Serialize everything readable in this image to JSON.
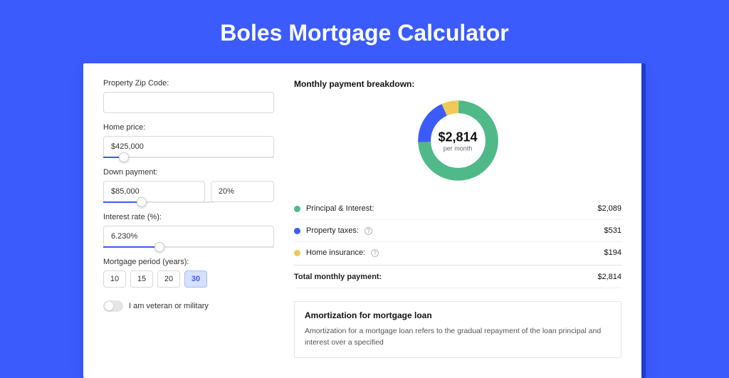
{
  "page_title": "Boles Mortgage Calculator",
  "form": {
    "zip_label": "Property Zip Code:",
    "zip_value": "",
    "home_price_label": "Home price:",
    "home_price_value": "$425,000",
    "down_payment_label": "Down payment:",
    "down_payment_value": "$85,000",
    "down_payment_pct": "20%",
    "interest_label": "Interest rate (%):",
    "interest_value": "6.230%",
    "period_label": "Mortgage period (years):",
    "periods": [
      "10",
      "15",
      "20",
      "30"
    ],
    "veteran_label": "I am veteran or military"
  },
  "breakdown": {
    "title": "Monthly payment breakdown:",
    "center_value": "$2,814",
    "center_sub": "per month",
    "items": [
      {
        "label": "Principal & Interest:",
        "value": "$2,089"
      },
      {
        "label": "Property taxes:",
        "value": "$531"
      },
      {
        "label": "Home insurance:",
        "value": "$194"
      }
    ],
    "total_label": "Total monthly payment:",
    "total_value": "$2,814"
  },
  "amort": {
    "title": "Amortization for mortgage loan",
    "text": "Amortization for a mortgage loan refers to the gradual repayment of the loan principal and interest over a specified"
  },
  "chart_data": {
    "type": "pie",
    "title": "Monthly payment breakdown",
    "series": [
      {
        "name": "Principal & Interest",
        "value": 2089,
        "color": "#4fb98a"
      },
      {
        "name": "Property taxes",
        "value": 531,
        "color": "#3b5bfd"
      },
      {
        "name": "Home insurance",
        "value": 194,
        "color": "#f0c95a"
      }
    ],
    "total": 2814,
    "center_label": "$2,814 per month"
  }
}
